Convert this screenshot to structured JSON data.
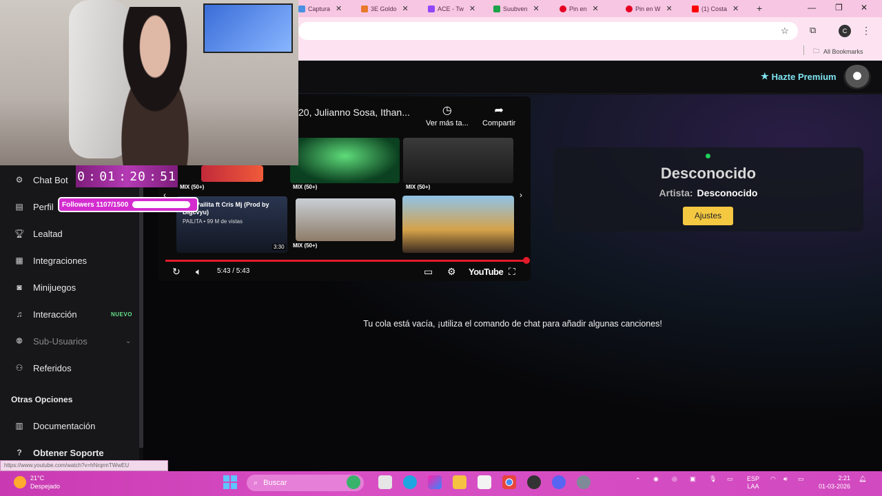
{
  "browser": {
    "tabs": [
      {
        "label": "Captura",
        "color": "#4a90e2"
      },
      {
        "label": "3E Goldo",
        "color": "#e8792b"
      },
      {
        "label": "ACE - Tw",
        "color": "#9146ff"
      },
      {
        "label": "Suubven",
        "color": "#1aa34a"
      },
      {
        "label": "Pin en ",
        "color": "#e60023"
      },
      {
        "label": "Pin en W",
        "color": "#e60023"
      },
      {
        "label": "(1) Costa",
        "color": "#ff0000"
      }
    ],
    "profile_initial": "C",
    "all_bookmarks": "All Bookmarks"
  },
  "header": {
    "premium_label": "Hazte Premium"
  },
  "overlay": {
    "timer": [
      "0",
      "01",
      "20",
      "51"
    ],
    "followers_label": "Followers 1107/1500",
    "followers_progress": 0.738
  },
  "sidebar": {
    "items": [
      {
        "label": "Chat Bot",
        "icon": "robot-icon"
      },
      {
        "label": "Perfil",
        "icon": "id-card-icon"
      },
      {
        "label": "Lealtad",
        "icon": "trophy-icon"
      },
      {
        "label": "Integraciones",
        "icon": "chart-icon"
      },
      {
        "label": "Minijuegos",
        "icon": "gamepad-icon"
      },
      {
        "label": "Interacción",
        "icon": "music-icon"
      },
      {
        "label": "Sub-Usuarios",
        "icon": "users-icon"
      },
      {
        "label": "Referidos",
        "icon": "people-icon"
      }
    ],
    "nuevo_badge": "NUEVO",
    "section_other": "Otras Opciones",
    "other_items": [
      {
        "label": "Documentación",
        "icon": "docs-icon"
      },
      {
        "label": "Obtener Soporte",
        "icon": "help-icon"
      }
    ],
    "url_hint": "https://www.youtube.com/watch?v=hNrqrmTWwEU"
  },
  "player": {
    "title": "20, Julianno Sosa, Ithan...",
    "watch_later": "Ver más ta...",
    "share": "Compartir",
    "mix_label": "MIX (50+)",
    "featured_title": "Tú - Pailita ft Cris Mj (Prod by Bigcvyu)",
    "featured_sub": "PAILITA • 99 M de vistas",
    "featured_duration": "3:30",
    "time": "5:43 / 5:43",
    "progress": 1.0,
    "youtube_logo": "YouTube"
  },
  "now_playing": {
    "song": "Desconocido",
    "artist_key": "Artista:",
    "artist_value": "Desconocido",
    "settings_button": "Ajustes"
  },
  "queue": {
    "empty_message": "Tu cola está vacía, ¡utiliza el comando de chat para añadir algunas canciones!"
  },
  "taskbar": {
    "temperature": "21°C",
    "weather": "Despejado",
    "search_placeholder": "Buscar",
    "lang": "ESP",
    "lang_sub": "LAA",
    "time": "2:21",
    "date": "01-03-2026"
  }
}
